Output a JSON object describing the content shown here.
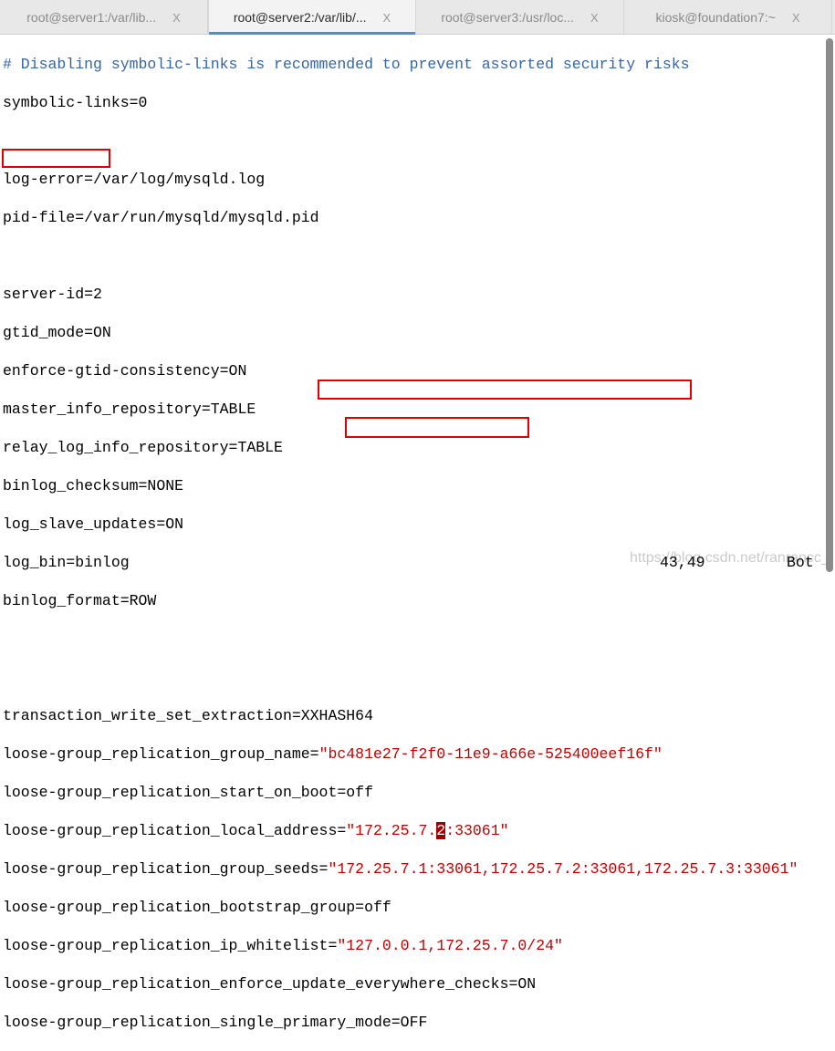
{
  "tabs": [
    {
      "label": "root@server1:/var/lib...",
      "active": false
    },
    {
      "label": "root@server2:/var/lib/...",
      "active": true
    },
    {
      "label": "root@server3:/usr/loc...",
      "active": false
    },
    {
      "label": "kiosk@foundation7:~",
      "active": false
    }
  ],
  "tab_close": "X",
  "lines": {
    "l0": "# Disabling symbolic-links is recommended to prevent assorted security risks",
    "l1": "symbolic-links=0",
    "l3": "log-error=/var/log/mysqld.log",
    "l4": "pid-file=/var/run/mysqld/mysqld.pid",
    "l6": "server-id=2",
    "l7": "gtid_mode=ON",
    "l8": "enforce-gtid-consistency=ON",
    "l9": "master_info_repository=TABLE",
    "l10": "relay_log_info_repository=TABLE",
    "l11": "binlog_checksum=NONE",
    "l12": "log_slave_updates=ON",
    "l13": "log_bin=binlog",
    "l14": "binlog_format=ROW",
    "l17": "transaction_write_set_extraction=XXHASH64",
    "l18k": "loose-group_replication_group_name=",
    "l18v": "\"bc481e27-f2f0-11e9-a66e-525400eef16f\"",
    "l19": "loose-group_replication_start_on_boot=off",
    "l20k": "loose-group_replication_local_address=",
    "l20a": "\"172.25.7.",
    "l20c": "2",
    "l20b": ":33061\"",
    "l21k": "loose-group_replication_group_seeds=",
    "l21v": "\"172.25.7.1:33061,172.25.7.2:33061,172.25.7.3:33061\"",
    "l22": "loose-group_replication_bootstrap_group=off",
    "l23k": "loose-group_replication_ip_whitelist=",
    "l23v": "\"127.0.0.1,172.25.7.0/24\"",
    "l24": "loose-group_replication_enforce_update_everywhere_checks=ON",
    "l25": "loose-group_replication_single_primary_mode=OFF"
  },
  "status": {
    "position": "43,49",
    "scroll": "Bot"
  },
  "watermark": "https://blog.csdn.net/ranrancc_",
  "colors": {
    "comment": "#3465a4",
    "string": "#c00000",
    "highlight_box": "#e00000",
    "tab_accent": "#4a90d9"
  }
}
